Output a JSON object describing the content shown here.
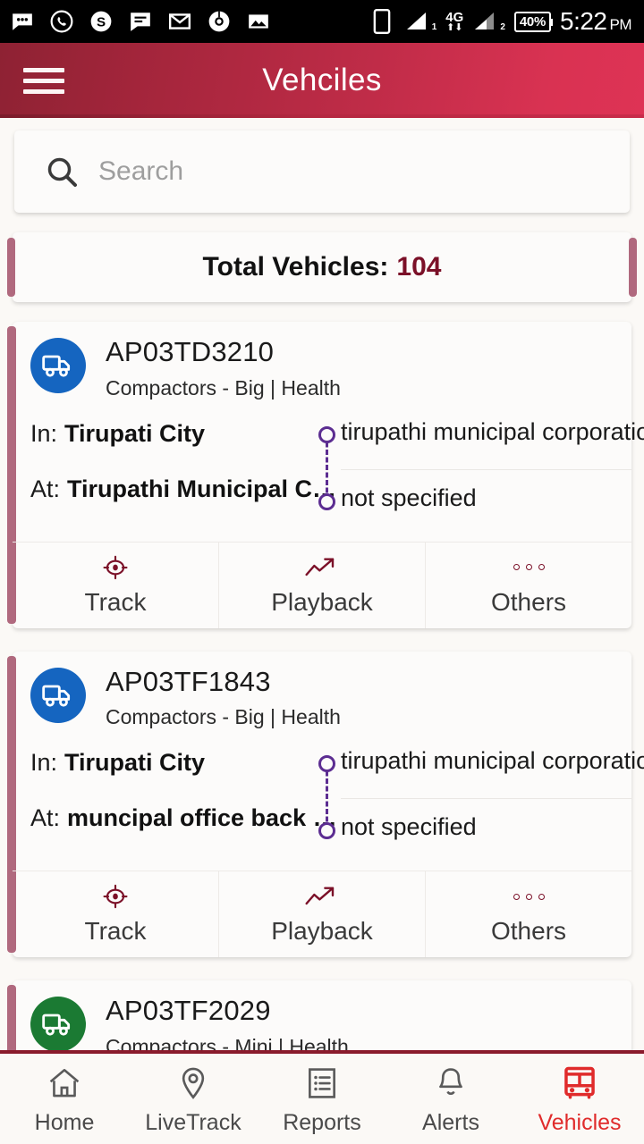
{
  "status_bar": {
    "icons": [
      "messages-icon",
      "whatsapp-icon",
      "skype-icon",
      "sms-icon",
      "gmail-icon",
      "chrome-icon",
      "photos-icon"
    ],
    "device_icon": "phone-icon",
    "network_label": "4G",
    "sim1_label": "1",
    "sim2_label": "2",
    "battery_label": "40%",
    "time": "5:22",
    "time_period": "PM"
  },
  "app_bar": {
    "menu_icon": "hamburger-menu-icon",
    "title": "Vehciles"
  },
  "search": {
    "icon": "search-icon",
    "value": "",
    "placeholder": "Search"
  },
  "summary": {
    "label": "Total Vehicles:",
    "count": "104"
  },
  "actions": {
    "track": {
      "label": "Track",
      "icon": "target-crosshair-icon"
    },
    "playback": {
      "label": "Playback",
      "icon": "trending-up-arrow-icon"
    },
    "others": {
      "label": "Others",
      "icon": "three-dots-icon"
    }
  },
  "labels": {
    "in": "In:",
    "at": "At:"
  },
  "colors": {
    "appbar_left": "#8E2233",
    "appbar_right": "#DE3355",
    "card_accent": "#B0697E",
    "count_accent": "#7B1028",
    "timeline_dot": "#5C2D91",
    "status_blue": "#1565C0",
    "status_green": "#1B7A33",
    "nav_active": "#E02B2B"
  },
  "vehicles": [
    {
      "reg_no": "AP03TD3210",
      "type": "Compactors - Big | Health",
      "status_color": "#1565C0",
      "icon": "truck-icon",
      "in_value": "Tirupati City",
      "at_value": "Tirupathi Municipal C…",
      "zone": "tirupathi municipal corporatio",
      "driver": "not specified",
      "has_actions": true
    },
    {
      "reg_no": "AP03TF1843",
      "type": "Compactors - Big | Health",
      "status_color": "#1565C0",
      "icon": "truck-icon",
      "in_value": "Tirupati City",
      "at_value": "muncipal office back …",
      "zone": "tirupathi municipal corporatio",
      "driver": "not specified",
      "has_actions": true
    },
    {
      "reg_no": "AP03TF2029",
      "type": "Compactors - Mini | Health",
      "status_color": "#1B7A33",
      "icon": "truck-icon",
      "in_value": "",
      "at_value": "",
      "zone": "",
      "driver": "",
      "has_actions": false
    }
  ],
  "bottom_nav": [
    {
      "label": "Home",
      "icon": "home-icon",
      "active": false
    },
    {
      "label": "LiveTrack",
      "icon": "map-pin-icon",
      "active": false
    },
    {
      "label": "Reports",
      "icon": "list-document-icon",
      "active": false
    },
    {
      "label": "Alerts",
      "icon": "bell-icon",
      "active": false
    },
    {
      "label": "Vehicles",
      "icon": "bus-icon",
      "active": true
    }
  ]
}
